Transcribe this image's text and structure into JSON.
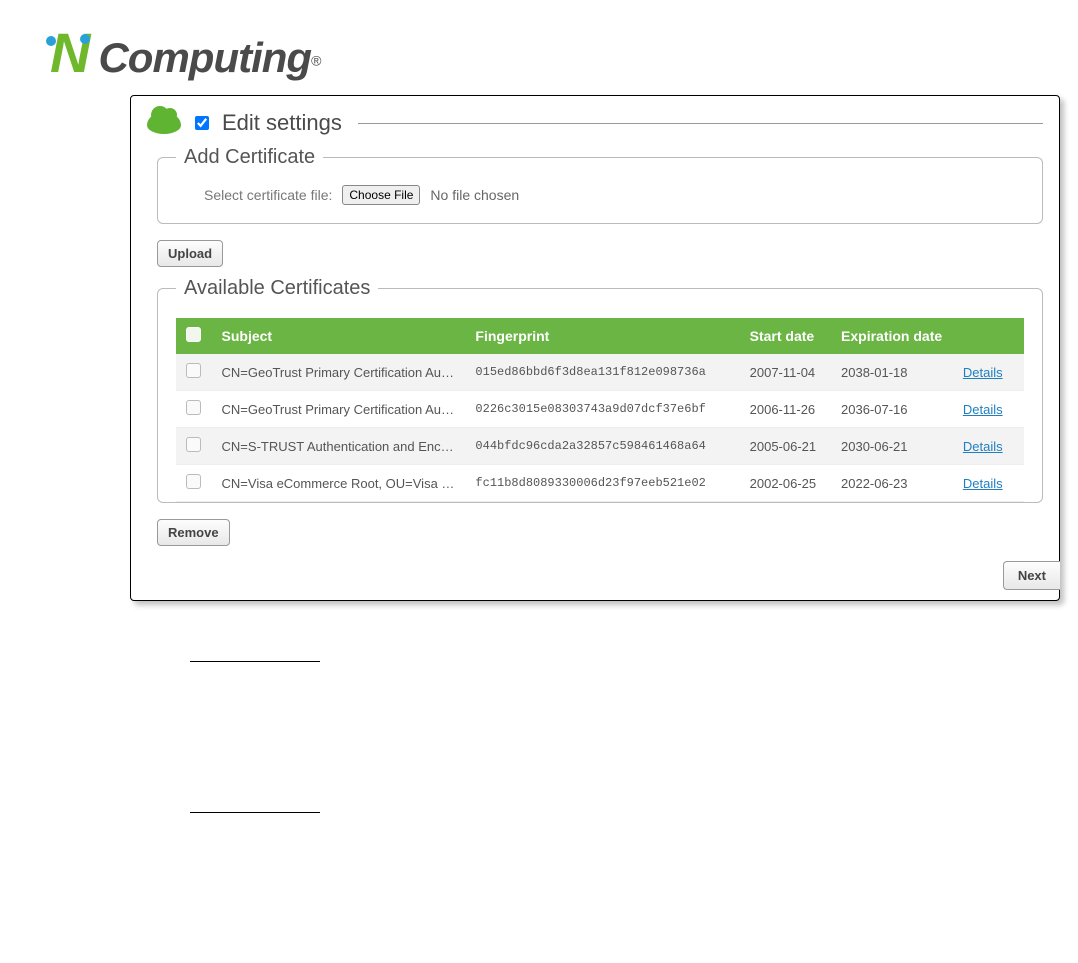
{
  "logo": {
    "n": "N",
    "rest": "Computing",
    "reg": "®"
  },
  "edit": {
    "title": "Edit settings"
  },
  "add": {
    "legend": "Add Certificate",
    "label": "Select certificate file:",
    "choose": "Choose File",
    "nofile": "No file chosen"
  },
  "buttons": {
    "upload": "Upload",
    "remove": "Remove",
    "next": "Next"
  },
  "avail": {
    "legend": "Available Certificates"
  },
  "headers": {
    "subject": "Subject",
    "fingerprint": "Fingerprint",
    "start": "Start date",
    "exp": "Expiration date"
  },
  "detailsLabel": "Details",
  "rows": [
    {
      "subject": "CN=GeoTrust Primary Certification Auth...",
      "fingerprint": "015ed86bbd6f3d8ea131f812e098736a",
      "start": "2007-11-04",
      "exp": "2038-01-18"
    },
    {
      "subject": "CN=GeoTrust Primary Certification Auth...",
      "fingerprint": "0226c3015e08303743a9d07dcf37e6bf",
      "start": "2006-11-26",
      "exp": "2036-07-16"
    },
    {
      "subject": "CN=S-TRUST Authentication and Encryp...",
      "fingerprint": "044bfdc96cda2a32857c598461468a64",
      "start": "2005-06-21",
      "exp": "2030-06-21"
    },
    {
      "subject": "CN=Visa eCommerce Root, OU=Visa Int...",
      "fingerprint": "fc11b8d8089330006d23f97eeb521e02",
      "start": "2002-06-25",
      "exp": "2022-06-23"
    }
  ]
}
